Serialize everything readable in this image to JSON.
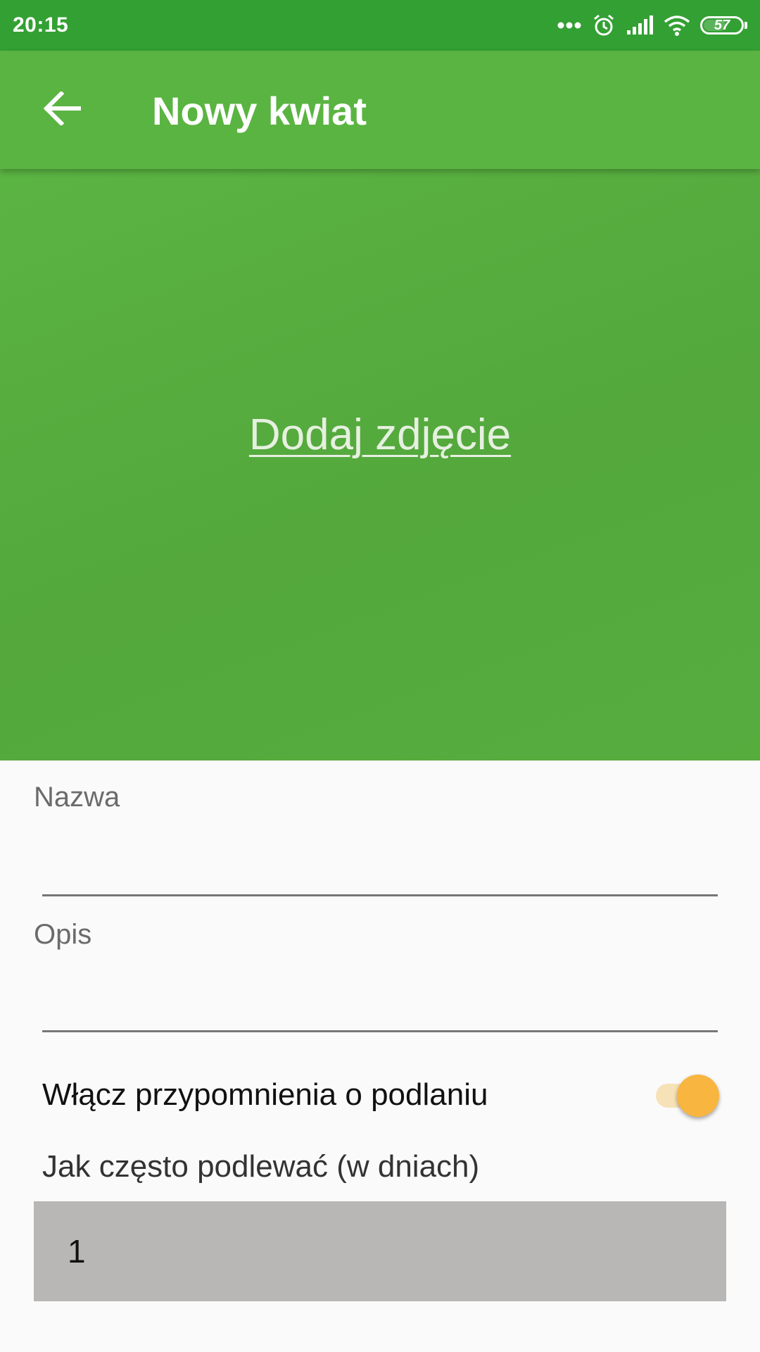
{
  "status_bar": {
    "time": "20:15",
    "battery_level": "57",
    "icons": [
      "more-dots-icon",
      "alarm-icon",
      "signal-icon",
      "wifi-icon",
      "battery-icon"
    ]
  },
  "app_bar": {
    "title": "Nowy kwiat",
    "back_icon": "arrow-back-icon",
    "color": "#5ab442"
  },
  "photo": {
    "add_photo_label": "Dodaj zdjęcie",
    "background_color": "#56ad3e"
  },
  "form": {
    "name_label": "Nazwa",
    "name_value": "",
    "description_label": "Opis",
    "description_value": "",
    "reminder_label": "Włącz przypomnienia o podlaniu",
    "reminder_enabled": true,
    "frequency_label": "Jak często podlewać (w dniach)",
    "frequency_value": "1"
  },
  "colors": {
    "status_bar": "#33a033",
    "accent": "#f8b540",
    "input_bg": "#b8b7b6"
  }
}
